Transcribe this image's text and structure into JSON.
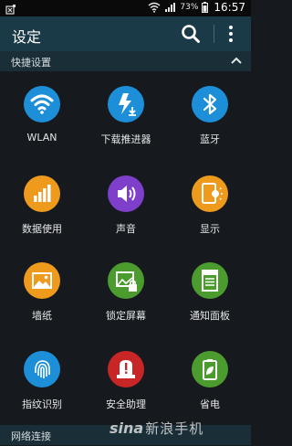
{
  "status_bar": {
    "battery": "73%",
    "time": "16:57"
  },
  "action_bar": {
    "title": "设定"
  },
  "sections": {
    "quick": "快捷设置",
    "network": "网络连接"
  },
  "tiles": [
    {
      "label": "WLAN",
      "color": "#1d8fd8",
      "icon": "wifi-icon"
    },
    {
      "label": "下载推进器",
      "color": "#1d8fd8",
      "icon": "download-booster-icon"
    },
    {
      "label": "蓝牙",
      "color": "#1d8fd8",
      "icon": "bluetooth-icon"
    },
    {
      "label": "数据使用",
      "color": "#ee9a1c",
      "icon": "data-usage-icon"
    },
    {
      "label": "声音",
      "color": "#7e3fcb",
      "icon": "sound-icon"
    },
    {
      "label": "显示",
      "color": "#ee9a1c",
      "icon": "display-icon"
    },
    {
      "label": "墙纸",
      "color": "#ee9a1c",
      "icon": "wallpaper-icon"
    },
    {
      "label": "锁定屏幕",
      "color": "#4c9b2f",
      "icon": "lock-screen-icon"
    },
    {
      "label": "通知面板",
      "color": "#4c9b2f",
      "icon": "notification-panel-icon"
    },
    {
      "label": "指纹识别",
      "color": "#1d8fd8",
      "icon": "fingerprint-icon"
    },
    {
      "label": "安全助理",
      "color": "#c82626",
      "icon": "safety-assistance-icon"
    },
    {
      "label": "省电",
      "color": "#4c9b2f",
      "icon": "power-saving-icon"
    }
  ],
  "watermark": {
    "logo": "sina",
    "text": "新浪手机"
  }
}
